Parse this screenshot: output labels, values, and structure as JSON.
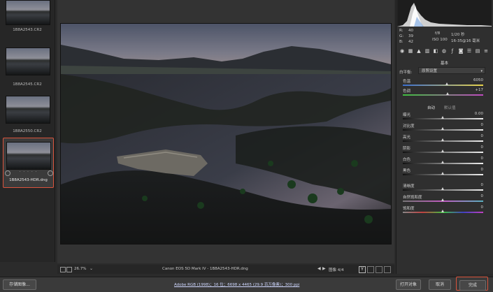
{
  "filmstrip": {
    "items": [
      {
        "label": "1B8A2543.CR2"
      },
      {
        "label": "1B8A2545.CR2"
      },
      {
        "label": "1B8A2550.CR2"
      },
      {
        "label": "1B8A2543-HDR.dng",
        "selected": true,
        "stars": "· · · · ·"
      }
    ]
  },
  "viewer": {
    "zoom": "26.7%",
    "camera_info": "Canon EOS 5D Mark IV  -  1B8A2543-HDR.dng",
    "image_counter": "图像 4/4"
  },
  "readout": {
    "r_label": "R:",
    "r_value": "40",
    "g_label": "G:",
    "g_value": "39",
    "b_label": "B:",
    "b_value": "42",
    "aperture": "f/8",
    "shutter": "1/20 秒",
    "iso": "ISO 100",
    "lens": "16-35@16 毫米"
  },
  "panel": {
    "section": "基本",
    "wb_label": "白平衡:",
    "wb_value": "原照设置",
    "tone_auto": "自动",
    "tone_default": "默认值",
    "sliders": [
      {
        "label": "色温",
        "value": "6050",
        "pos": 0.55
      },
      {
        "label": "色调",
        "value": "+17",
        "pos": 0.56
      },
      {
        "label": "曝光",
        "value": "0.00",
        "pos": 0.5
      },
      {
        "label": "对比度",
        "value": "0",
        "pos": 0.5
      },
      {
        "label": "高光",
        "value": "0",
        "pos": 0.5
      },
      {
        "label": "阴影",
        "value": "0",
        "pos": 0.5
      },
      {
        "label": "白色",
        "value": "0",
        "pos": 0.5
      },
      {
        "label": "黑色",
        "value": "0",
        "pos": 0.5
      },
      {
        "label": "清晰度",
        "value": "0",
        "pos": 0.5
      },
      {
        "label": "自然饱和度",
        "value": "0",
        "pos": 0.5
      },
      {
        "label": "饱和度",
        "value": "0",
        "pos": 0.5
      }
    ]
  },
  "bottom": {
    "save_label": "存储图像...",
    "workflow_info": "Adobe RGB (1998)；16 位；6698 x 4465 (29.9 百万像素)；300 ppi",
    "open_label": "打开对象",
    "cancel_label": "取消",
    "done_label": "完成"
  },
  "colors": {
    "highlight": "#d9533c"
  }
}
